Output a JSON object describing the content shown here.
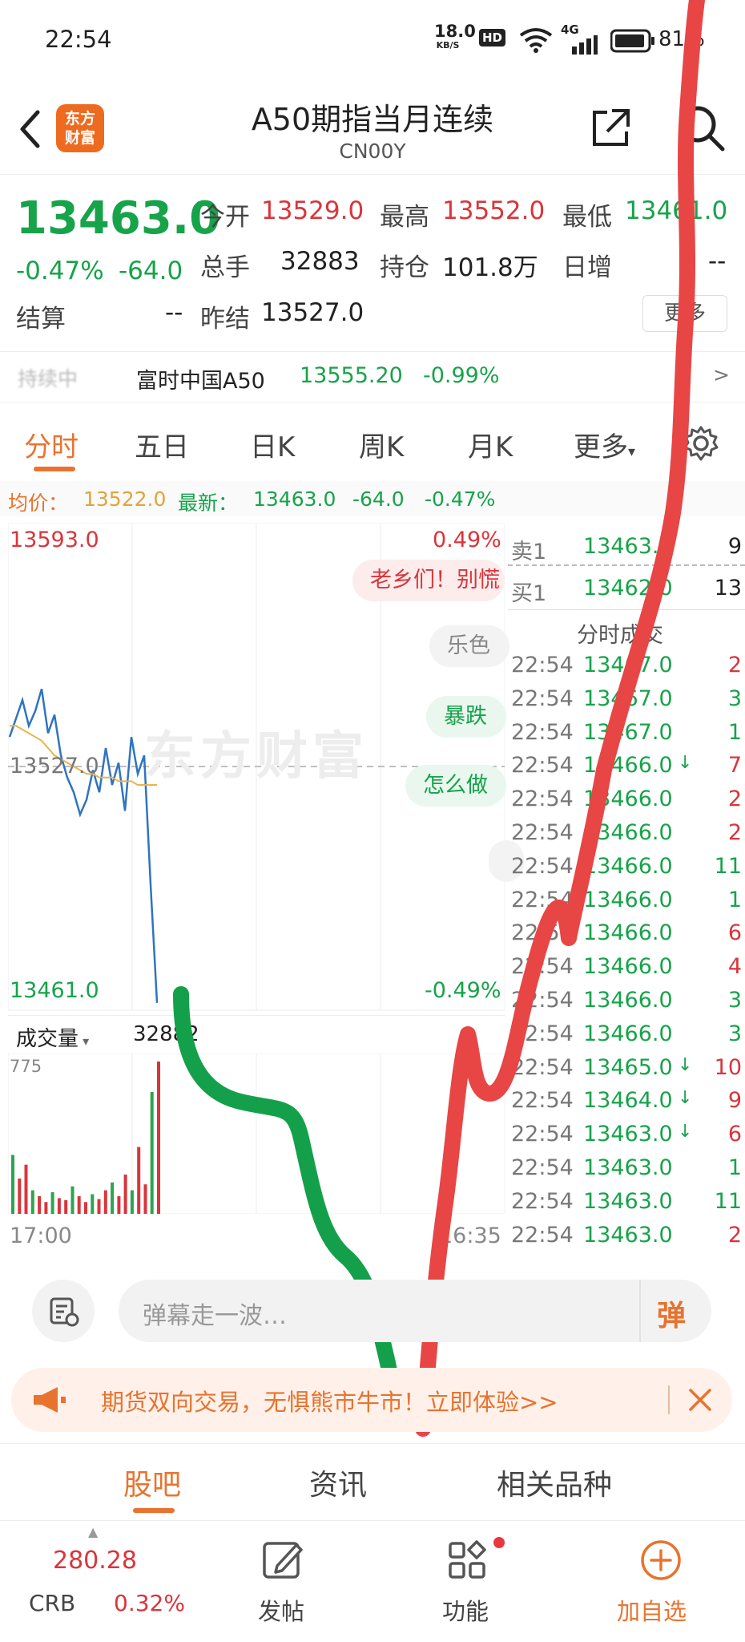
{
  "status_bar": {
    "time": "22:54",
    "net_speed_value": "18.0",
    "net_speed_unit": "KB/S",
    "hd_badge": "HD",
    "signal_label": "4G",
    "battery": "81%"
  },
  "header": {
    "logo_line1": "东方",
    "logo_line2": "财富",
    "title": "A50期指当月连续",
    "code": "CN00Y"
  },
  "quote": {
    "price": "13463.0",
    "change_pct": "-0.47%",
    "change": "-64.0",
    "open_label": "今开",
    "open": "13529.0",
    "high_label": "最高",
    "high": "13552.0",
    "low_label": "最低",
    "low": "13461.0",
    "volume_label": "总手",
    "volume": "32883",
    "position_label": "持仓",
    "position": "101.8万",
    "daily_inc_label": "日增",
    "daily_inc": "--",
    "settle_label": "结算",
    "settle": "--",
    "prev_settle_label": "昨结",
    "prev_settle": "13527.0",
    "more_label": "更多"
  },
  "index_row": {
    "status": "持续中",
    "name": "富时中国A50",
    "value": "13555.20",
    "change": "-0.99%",
    "arrow": ">"
  },
  "tabs": [
    "分时",
    "五日",
    "日K",
    "周K",
    "月K",
    "更多"
  ],
  "avg_row": {
    "avg_label": "均价：",
    "avg": "13522.0",
    "last_label": "最新：",
    "last": "13463.0",
    "change": "-64.0",
    "change_pct": "-0.47%"
  },
  "chart": {
    "top_label": "13593.0",
    "top_pct": "0.49%",
    "mid_label": "13527.0",
    "bottom_label": "13461.0",
    "bottom_pct": "-0.49%",
    "watermark": "东方财富",
    "volume_label": "成交量",
    "volume_value": "32882",
    "volume_max": "775",
    "time_start": "17:00",
    "time_end": "16:35"
  },
  "chart_data": {
    "type": "line",
    "ylim": [
      13461.0,
      13593.0
    ],
    "series": [
      {
        "values": [
          13535,
          13540,
          13545,
          13538,
          13542,
          13548,
          13536,
          13541,
          13530,
          13524,
          13520,
          13514,
          13518,
          13526,
          13520,
          13532,
          13522,
          13528,
          13515,
          13535,
          13525,
          13530,
          13495,
          13463
        ]
      },
      {
        "values": [
          13538,
          13538,
          13537,
          13536,
          13535,
          13534,
          13532,
          13530,
          13529,
          13528,
          13527,
          13526,
          13525,
          13525,
          13524,
          13524,
          13524,
          13523,
          13523,
          13523,
          13522,
          13522,
          13522,
          13522
        ]
      }
    ],
    "volume": [
      300,
      180,
      250,
      120,
      90,
      60,
      110,
      80,
      70,
      140,
      90,
      60,
      100,
      75,
      120,
      160,
      90,
      200,
      120,
      340,
      150,
      620,
      775
    ]
  },
  "bubbles": [
    "老乡们！别慌",
    "乐色",
    "暴跌",
    "怎么做"
  ],
  "orderbook": {
    "sell_label": "卖1",
    "sell_price": "13463.0",
    "sell_qty": "9",
    "buy_label": "买1",
    "buy_price": "13462.0",
    "buy_qty": "13",
    "trades_title": "分时成交",
    "trades": [
      {
        "time": "22:54",
        "price": "13467.0",
        "qty": "2",
        "dir": ""
      },
      {
        "time": "22:54",
        "price": "13467.0",
        "qty": "3",
        "dir": ""
      },
      {
        "time": "22:54",
        "price": "13467.0",
        "qty": "1",
        "dir": ""
      },
      {
        "time": "22:54",
        "price": "13466.0",
        "qty": "7",
        "dir": "↓"
      },
      {
        "time": "22:54",
        "price": "13466.0",
        "qty": "2",
        "dir": ""
      },
      {
        "time": "22:54",
        "price": "13466.0",
        "qty": "2",
        "dir": ""
      },
      {
        "time": "22:54",
        "price": "13466.0",
        "qty": "11",
        "dir": ""
      },
      {
        "time": "22:54",
        "price": "13466.0",
        "qty": "1",
        "dir": ""
      },
      {
        "time": "22:54",
        "price": "13466.0",
        "qty": "6",
        "dir": ""
      },
      {
        "time": "22:54",
        "price": "13466.0",
        "qty": "4",
        "dir": ""
      },
      {
        "time": "22:54",
        "price": "13466.0",
        "qty": "3",
        "dir": ""
      },
      {
        "time": "22:54",
        "price": "13466.0",
        "qty": "3",
        "dir": ""
      },
      {
        "time": "22:54",
        "price": "13465.0",
        "qty": "10",
        "dir": "↓"
      },
      {
        "time": "22:54",
        "price": "13464.0",
        "qty": "9",
        "dir": "↓"
      },
      {
        "time": "22:54",
        "price": "13463.0",
        "qty": "6",
        "dir": "↓"
      },
      {
        "time": "22:54",
        "price": "13463.0",
        "qty": "1",
        "dir": ""
      },
      {
        "time": "22:54",
        "price": "13463.0",
        "qty": "11",
        "dir": ""
      },
      {
        "time": "22:54",
        "price": "13463.0",
        "qty": "2",
        "dir": ""
      }
    ]
  },
  "comment": {
    "placeholder": "弹幕走一波…",
    "danmaku_label": "弹"
  },
  "promo": {
    "text": "期货双向交易，无惧熊市牛市！立即体验>>"
  },
  "sub_tabs": [
    "股吧",
    "资讯",
    "相关品种"
  ],
  "bottom_nav": {
    "crb_value": "280.28",
    "crb_label": "CRB",
    "crb_change": "0.32%",
    "post_label": "发帖",
    "function_label": "功能",
    "add_label": "加自选"
  },
  "colors": {
    "up": "#d9353b",
    "down": "#17a34a",
    "accent": "#e8732e",
    "price_line": "#2f74c0",
    "avg_line": "#e9b44c",
    "overlay_green": "#14a04a",
    "overlay_red": "#e84545"
  }
}
